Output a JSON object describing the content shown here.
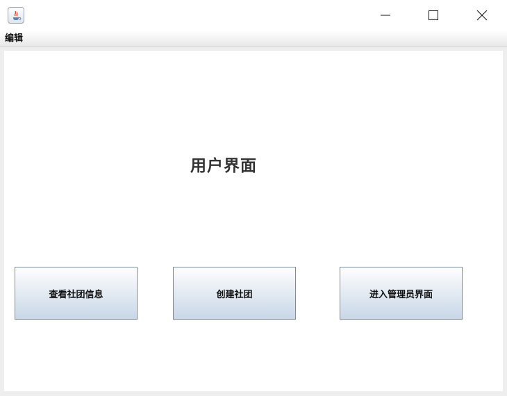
{
  "window": {
    "minimize_icon": "minimize-icon",
    "maximize_icon": "maximize-icon",
    "close_icon": "close-icon",
    "app_icon": "java-coffee-cup-icon"
  },
  "menubar": {
    "items": [
      {
        "label": "编辑"
      }
    ]
  },
  "main": {
    "title": "用户界面",
    "buttons": [
      {
        "label": "查看社团信息"
      },
      {
        "label": "创建社团"
      },
      {
        "label": "进入管理员界面"
      }
    ]
  },
  "colors": {
    "button_border": "#7a8aa0",
    "button_gradient_bottom": "#c8d7e8",
    "title_text": "#333333"
  }
}
